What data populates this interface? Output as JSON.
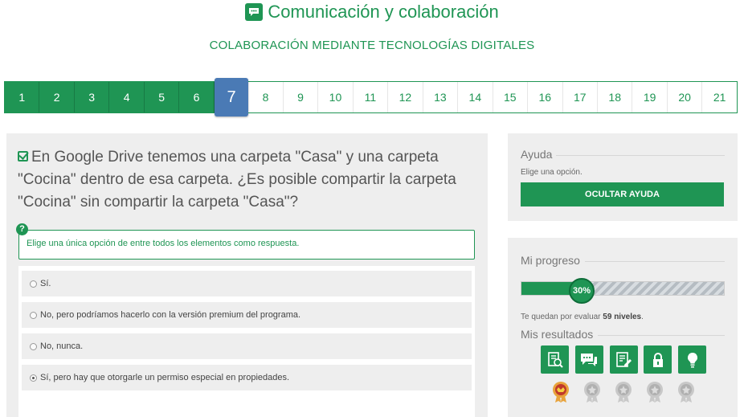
{
  "header": {
    "title": "Comunicación y colaboración",
    "subtitle": "COLABORACIÓN MEDIANTE TECNOLOGÍAS DIGITALES",
    "icon": "chat-bubble-icon"
  },
  "steps": {
    "labels": [
      "1",
      "2",
      "3",
      "4",
      "5",
      "6",
      "7",
      "8",
      "9",
      "10",
      "11",
      "12",
      "13",
      "14",
      "15",
      "16",
      "17",
      "18",
      "19",
      "20",
      "21"
    ],
    "current": "7"
  },
  "question": {
    "text": "En Google Drive tenemos una carpeta \"Casa\" y una carpeta \"Cocina\" dentro de esa carpeta. ¿Es posible compartir la carpeta \"Cocina\" sin compartir la carpeta \"Casa\"?",
    "instruction": "Elige una única opción de entre todos los elementos como respuesta.",
    "options": [
      "Sí.",
      "No, pero podríamos hacerlo con la versión premium del programa.",
      "No, nunca.",
      "Sí, pero hay que otorgarle un permiso especial en propiedades."
    ],
    "selected_option": "Sí, pero hay que otorgarle un permiso especial en propiedades."
  },
  "help": {
    "heading": "Ayuda",
    "hint": "Elige una opción.",
    "button": "OCULTAR AYUDA"
  },
  "progress": {
    "heading": "Mi progreso",
    "percent_label": "30%",
    "percent": 30,
    "remaining_prefix": "Te quedan por evaluar ",
    "remaining_value": "59 niveles",
    "remaining_suffix": ".",
    "results_heading": "Mis resultados",
    "result_icons": [
      "search-document-icon",
      "chat-icon",
      "edit-document-icon",
      "lock-icon",
      "lightbulb-icon"
    ],
    "medals": [
      "medal-gold-icon",
      "medal-grey-icon",
      "medal-grey-icon",
      "medal-grey-icon",
      "medal-grey-icon"
    ]
  },
  "colors": {
    "brand": "#1f9554",
    "current_step": "#4a7ab5",
    "panel": "#eeeeee"
  }
}
